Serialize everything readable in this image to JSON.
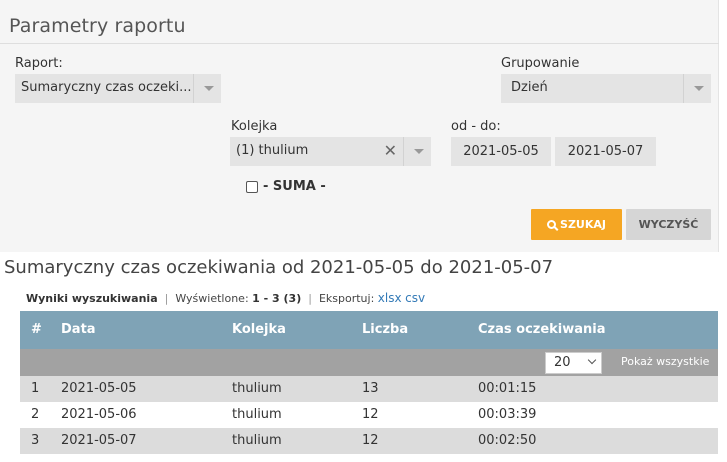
{
  "panel": {
    "title": "Parametry raportu",
    "report_label": "Raport:",
    "report_value": "Sumaryczny czas oczeki...",
    "grouping_label": "Grupowanie",
    "grouping_value": "Dzień",
    "queue_label": "Kolejka",
    "queue_value": "(1) thulium",
    "daterange_label": "od - do:",
    "date_from": "2021-05-05",
    "date_to": "2021-05-07",
    "sum_label": "- SUMA -",
    "search_button": "SZUKAJ",
    "clear_button": "WYCZYŚĆ"
  },
  "results": {
    "title": "Sumaryczny czas oczekiwania od 2021-05-05 do 2021-05-07",
    "heading": "Wyniki wyszukiwania",
    "shown_label": "Wyświetlone:",
    "shown_value": "1 - 3 (3)",
    "export_label": "Eksportuj:",
    "export_xlsx": "xlsx",
    "export_csv": "csv",
    "per_page": "20",
    "show_all": "Pokaż wszystkie",
    "columns": [
      "#",
      "Data",
      "Kolejka",
      "Liczba",
      "Czas oczekiwania"
    ],
    "rows": [
      [
        "1",
        "2021-05-05",
        "thulium",
        "13",
        "00:01:15"
      ],
      [
        "2",
        "2021-05-06",
        "thulium",
        "12",
        "00:03:39"
      ],
      [
        "3",
        "2021-05-07",
        "thulium",
        "12",
        "00:02:50"
      ]
    ]
  }
}
